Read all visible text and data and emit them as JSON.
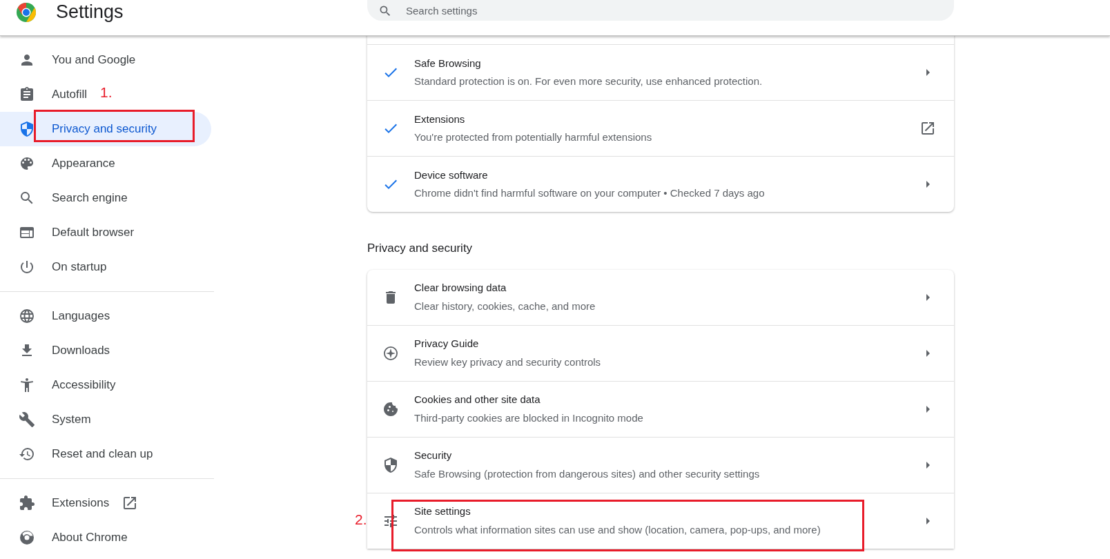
{
  "header": {
    "title": "Settings",
    "search": {
      "placeholder": "Search settings"
    }
  },
  "sidebar": {
    "groups": [
      {
        "items": [
          {
            "label": "You and Google",
            "selected": false
          },
          {
            "label": "Autofill",
            "selected": false
          },
          {
            "label": "Privacy and security",
            "selected": true,
            "annotation": "1."
          },
          {
            "label": "Appearance",
            "selected": false
          },
          {
            "label": "Search engine",
            "selected": false
          },
          {
            "label": "Default browser",
            "selected": false
          },
          {
            "label": "On startup",
            "selected": false
          }
        ]
      },
      {
        "items": [
          {
            "label": "Languages",
            "selected": false
          },
          {
            "label": "Downloads",
            "selected": false
          },
          {
            "label": "Accessibility",
            "selected": false
          },
          {
            "label": "System",
            "selected": false
          },
          {
            "label": "Reset and clean up",
            "selected": false
          }
        ]
      },
      {
        "items": [
          {
            "label": "Extensions",
            "selected": false,
            "kind": "external"
          },
          {
            "label": "About Chrome",
            "selected": false
          }
        ]
      }
    ]
  },
  "safety_card": {
    "rows": [
      {
        "title": "Safe Browsing",
        "subtitle": "Standard protection is on. For even more security, use enhanced protection.",
        "kind": "arrow"
      },
      {
        "title": "Extensions",
        "subtitle": "You're protected from potentially harmful extensions",
        "kind": "external"
      },
      {
        "title": "Device software",
        "subtitle": "Chrome didn't find harmful software on your computer • Checked 7 days ago",
        "kind": "arrow"
      }
    ]
  },
  "privacy_section": {
    "heading": "Privacy and security",
    "rows": [
      {
        "title": "Clear browsing data",
        "subtitle": "Clear history, cookies, cache, and more",
        "kind": "arrow"
      },
      {
        "title": "Privacy Guide",
        "subtitle": "Review key privacy and security controls",
        "kind": "arrow"
      },
      {
        "title": "Cookies and other site data",
        "subtitle": "Third-party cookies are blocked in Incognito mode",
        "kind": "arrow"
      },
      {
        "title": "Security",
        "subtitle": "Safe Browsing (protection from dangerous sites) and other security settings",
        "kind": "arrow"
      },
      {
        "title": "Site settings",
        "subtitle": "Controls what information sites can use and show (location, camera, pop-ups, and more)",
        "kind": "arrow",
        "annotation": "2."
      }
    ]
  }
}
